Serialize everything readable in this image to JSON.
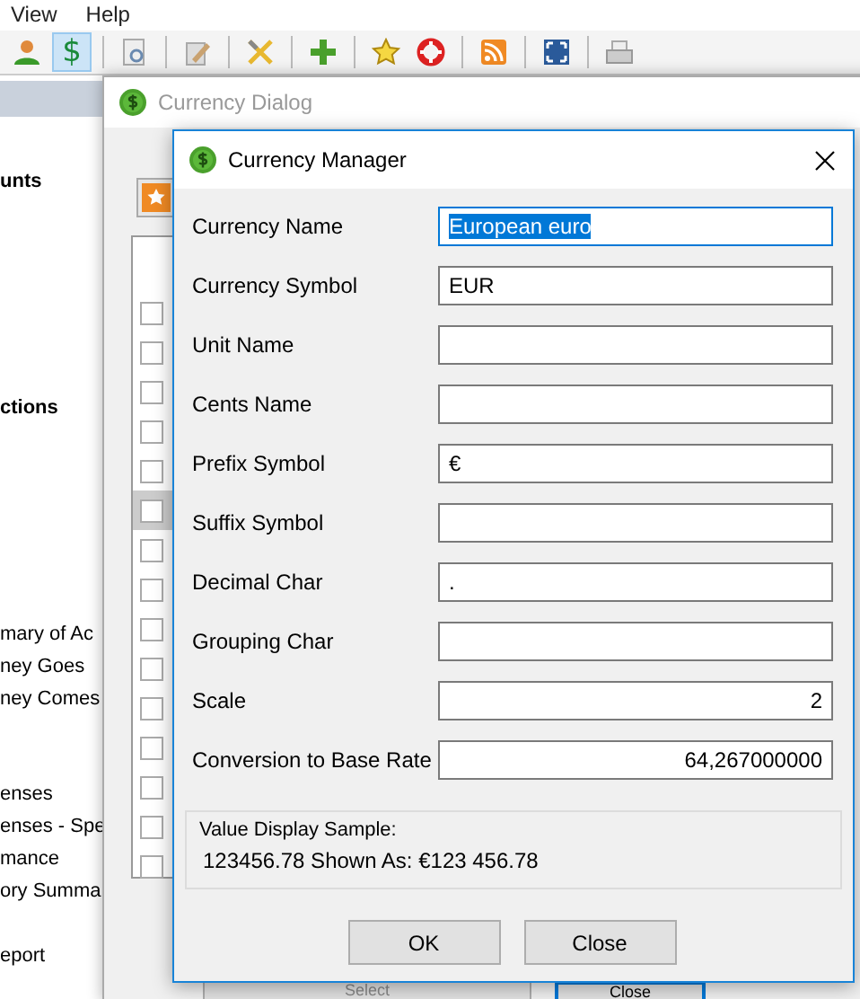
{
  "menu": [
    {
      "label": "View"
    },
    {
      "label": "Help"
    }
  ],
  "toolbar": [
    {
      "kind": "person",
      "selected": false
    },
    {
      "kind": "dollar",
      "label": "$",
      "selected": true
    },
    {
      "kind": "separator"
    },
    {
      "kind": "report",
      "selected": false
    },
    {
      "kind": "separator"
    },
    {
      "kind": "edit",
      "selected": false
    },
    {
      "kind": "separator"
    },
    {
      "kind": "tools",
      "selected": false
    },
    {
      "kind": "separator"
    },
    {
      "kind": "plus",
      "selected": false
    },
    {
      "kind": "separator"
    },
    {
      "kind": "star",
      "selected": false
    },
    {
      "kind": "lifebuoy",
      "selected": false
    },
    {
      "kind": "separator"
    },
    {
      "kind": "rss",
      "selected": false
    },
    {
      "kind": "separator"
    },
    {
      "kind": "fullscreen",
      "selected": false
    },
    {
      "kind": "separator"
    },
    {
      "kind": "print",
      "selected": false
    }
  ],
  "sidebar": {
    "items": [
      {
        "label": "unts",
        "kind": "heading"
      },
      {
        "label": "ctions",
        "kind": "heading"
      },
      {
        "label": "mary of Ac",
        "kind": "item"
      },
      {
        "label": "ney Goes",
        "kind": "item"
      },
      {
        "label": "ney Comes",
        "kind": "item"
      },
      {
        "label": "enses",
        "kind": "item"
      },
      {
        "label": "enses - Spe",
        "kind": "item"
      },
      {
        "label": "mance",
        "kind": "item"
      },
      {
        "label": "ory Summa",
        "kind": "item"
      },
      {
        "label": "eport",
        "kind": "item"
      }
    ]
  },
  "currency_dialog": {
    "title": "Currency Dialog",
    "rows": [
      {
        "checked": false,
        "selected": false
      },
      {
        "checked": false,
        "selected": false
      },
      {
        "checked": false,
        "selected": false
      },
      {
        "checked": false,
        "selected": false
      },
      {
        "checked": false,
        "selected": false
      },
      {
        "checked": false,
        "selected": true
      },
      {
        "checked": false,
        "selected": false
      },
      {
        "checked": false,
        "selected": false
      },
      {
        "checked": false,
        "selected": false
      },
      {
        "checked": false,
        "selected": false
      },
      {
        "checked": false,
        "selected": false
      },
      {
        "checked": false,
        "selected": false
      },
      {
        "checked": false,
        "selected": false
      },
      {
        "checked": false,
        "selected": false
      },
      {
        "checked": false,
        "selected": false
      }
    ],
    "buttons": [
      {
        "label": "Select",
        "focused": false
      },
      {
        "label": "Close",
        "focused": true
      }
    ]
  },
  "currency_manager": {
    "title": "Currency Manager",
    "fields": [
      {
        "label": "Currency Name",
        "value": "European euro",
        "kind": "text",
        "focused": true
      },
      {
        "label": "Currency Symbol",
        "value": "EUR",
        "kind": "text",
        "focused": false
      },
      {
        "label": "Unit Name",
        "kind": "text",
        "focused": false
      },
      {
        "label": "Cents Name",
        "kind": "text",
        "focused": false
      },
      {
        "label": "Prefix Symbol",
        "value": "€",
        "kind": "text",
        "focused": false
      },
      {
        "label": "Suffix Symbol",
        "kind": "text",
        "focused": false
      },
      {
        "label": "Decimal Char",
        "value": ".",
        "kind": "text",
        "focused": false
      },
      {
        "label": "Grouping Char",
        "kind": "text",
        "focused": false
      },
      {
        "label": "Scale",
        "value": "2",
        "kind": "number",
        "focused": false
      },
      {
        "label": "Conversion to Base Rate",
        "value": "64,267000000",
        "kind": "number",
        "focused": false
      }
    ],
    "sample": {
      "legend": "Value Display Sample:",
      "text": "123456.78 Shown As: €123 456.78"
    },
    "buttons": [
      "OK",
      "Close"
    ]
  }
}
